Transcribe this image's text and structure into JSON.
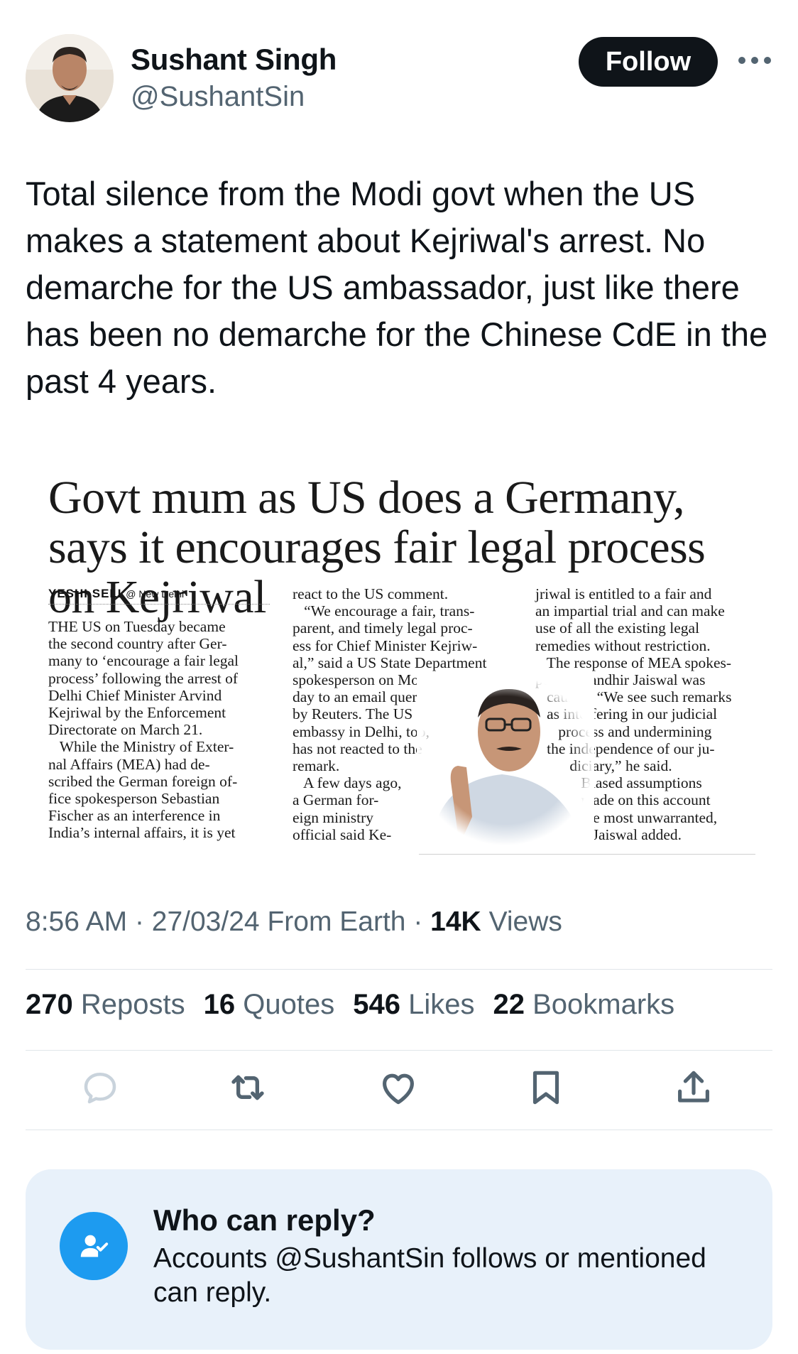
{
  "author": {
    "name": "Sushant Singh",
    "handle": "@SushantSin",
    "follow_label": "Follow",
    "more_icon": "more-horizontal-icon"
  },
  "tweet": {
    "text": "Total silence from the Modi govt when the US makes a statement about Kejriwal's arrest. No demarche for the US ambassador, just like there has been no demarche for the Chinese CdE in the past 4 years."
  },
  "clipping": {
    "headline": "Govt mum as US does a Germany, says it encourages fair legal process on Kejriwal",
    "byline_name": "YESHI SELI",
    "byline_place": "@ New Delhi",
    "column1": "THE US on Tuesday became\nthe second country after Ger-\nmany to ‘encourage a fair legal\nprocess’ following the arrest of\nDelhi Chief Minister Arvind\nKejriwal by the Enforcement\nDirectorate on March 21.\n   While the Ministry of Exter-\nnal Affairs (MEA) had de-\nscribed the German foreign of-\nfice spokesperson Sebastian\nFischer as an interference in\nIndia’s internal affairs, it is yet",
    "column2": "react to the US comment.\n   “We encourage a fair, trans-\nparent, and timely legal proc-\ness for Chief Minister Kejriw-\nal,” said a US State Department\nspokesperson on Mon-\nday to an email query\nby Reuters. The US\nembassy in Delhi, too,\nhas not reacted to the\nremark.\n   A few days ago,\na German for-\neign ministry\nofficial said Ke-",
    "column3": "jriwal is entitled to a fair and\nan impartial trial and can make\nuse of all the existing legal\nremedies without restriction.\n   The response of MEA spokes-\nperson Randhir Jaiswal was\n   caustic. “We see such remarks\n   as interfering in our judicial\n      process and undermining\n   the independence of our ju-\n         diciary,” he said.\n            Biased assumptions\n            made on this account\n            are most unwarranted,\n               Jaiswal added."
  },
  "meta": {
    "time": "8:56 AM",
    "date": "27/03/24",
    "location": "From Earth",
    "views_count": "14K",
    "views_label": "Views",
    "sep": "·"
  },
  "stats": [
    {
      "count": "270",
      "label": "Reposts"
    },
    {
      "count": "16",
      "label": "Quotes"
    },
    {
      "count": "546",
      "label": "Likes"
    },
    {
      "count": "22",
      "label": "Bookmarks"
    }
  ],
  "actions": [
    "reply-icon",
    "repost-icon",
    "like-icon",
    "bookmark-icon",
    "share-icon"
  ],
  "reply_settings": {
    "title": "Who can reply?",
    "description": "Accounts @SushantSin follows or mentioned can reply.",
    "icon": "person-check-icon"
  },
  "colors": {
    "text": "#0f1419",
    "secondary": "#536471",
    "accent": "#1d9bf0",
    "reply_box_bg": "#e8f1fa"
  }
}
